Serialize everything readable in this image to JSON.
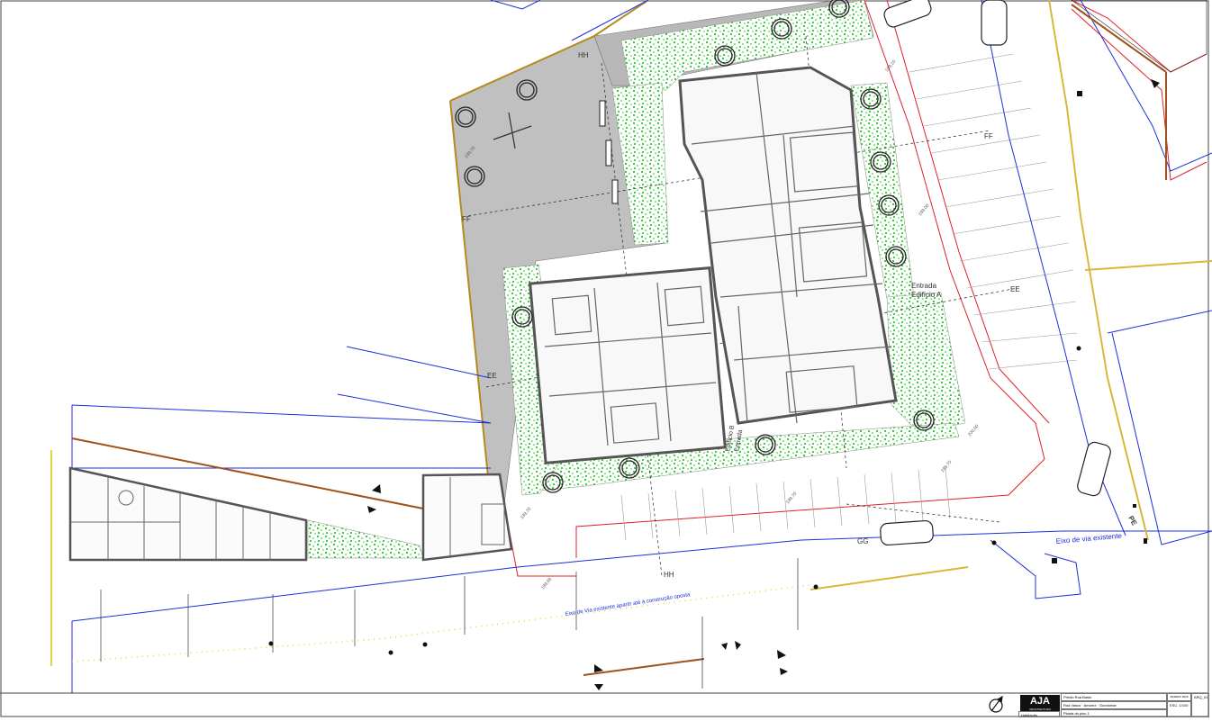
{
  "labels": {
    "ff_top": "FF",
    "ff_left": "FF",
    "hh_top": "HH",
    "hh_bottom": "HH",
    "ee_left": "EE",
    "ee_right": "EE",
    "gg": "GG",
    "entrance_a_1": "Entrada",
    "entrance_a_2": "Edifício A",
    "entrance_b_1": "Entrada",
    "entrance_b_2": "Edifício B",
    "pe": "PE",
    "axis_existing": "Eixo de via existente",
    "axis_existing_until": "Eixo de Via existente aparitr até à construção oposta"
  },
  "levels": {
    "l1": "199,70",
    "l2": "199,00",
    "l3": "198,70",
    "l4": "200,00",
    "l5": "199,70",
    "l6": "199,65",
    "l7": "199,10",
    "l8": "199,70"
  },
  "title_block": {
    "logo": "AJA",
    "logo_sub": "ARQUITECTURA",
    "project": "Prédio Rua Basto",
    "address": "Rua Vasco · Amorez · Gondomar",
    "drawing": "Planta do piso 1",
    "phase": "Habitação",
    "scale": "ESC. 1/100",
    "sheet": "ARQ_01",
    "date": "JANEIRO 2025"
  },
  "colors": {
    "pavement": "#c0c0c0",
    "greenery": "#1fd11f",
    "lot_red": "#e0202a",
    "axis_blue": "#1c2fd8",
    "boundary_brown": "#b5651d",
    "setback_yellow": "#e8d23a",
    "walls": "#555555"
  }
}
